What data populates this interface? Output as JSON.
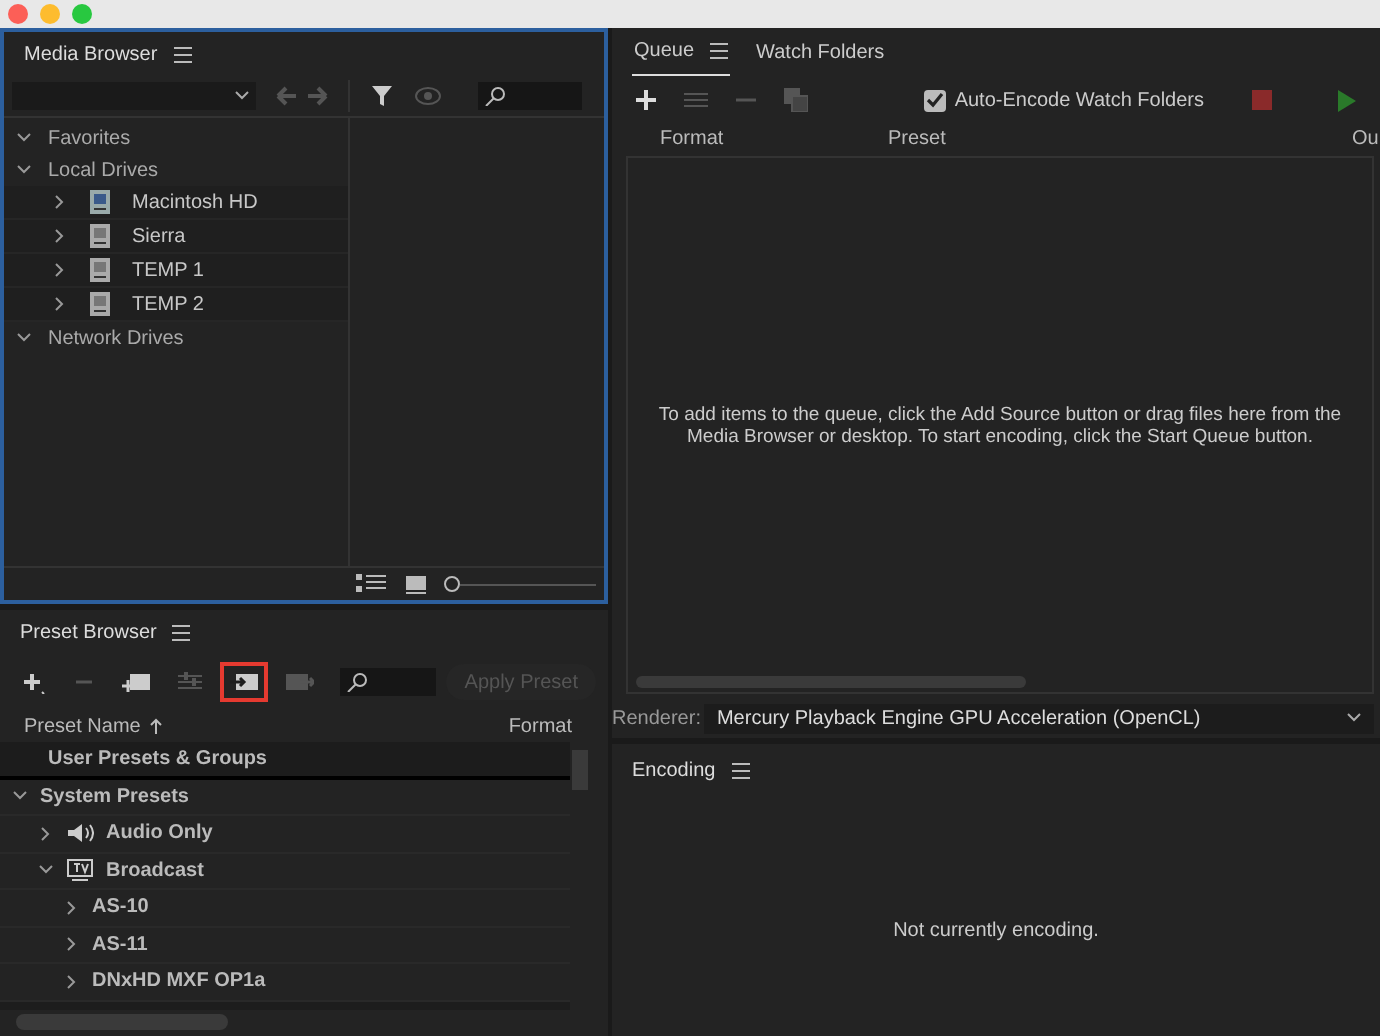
{
  "media_browser": {
    "title": "Media Browser",
    "tree": [
      {
        "label": "Favorites",
        "expanded": true
      },
      {
        "label": "Local Drives",
        "expanded": true,
        "children": [
          {
            "label": "Macintosh HD",
            "kind": "system-drive",
            "expanded": false
          },
          {
            "label": "Sierra",
            "kind": "drive",
            "expanded": false
          },
          {
            "label": "TEMP 1",
            "kind": "drive",
            "expanded": false
          },
          {
            "label": "TEMP 2",
            "kind": "drive",
            "expanded": false
          }
        ]
      },
      {
        "label": "Network Drives",
        "expanded": true
      }
    ],
    "zoom_slider": {
      "level": 0
    }
  },
  "preset_browser": {
    "title": "Preset Browser",
    "tools": [
      {
        "kind": "add",
        "disabled": false,
        "highlighted": false
      },
      {
        "kind": "remove",
        "disabled": true,
        "highlighted": false
      },
      {
        "kind": "new-group",
        "disabled": false,
        "highlighted": false
      },
      {
        "kind": "settings",
        "disabled": true,
        "highlighted": false
      },
      {
        "kind": "import",
        "disabled": false,
        "highlighted": true
      },
      {
        "kind": "export",
        "disabled": true,
        "highlighted": false
      }
    ],
    "apply_button": {
      "label": "Apply Preset",
      "disabled": true
    },
    "columns": [
      "Preset Name",
      "Format"
    ],
    "tree": [
      {
        "label": "User Presets & Groups",
        "kind": "group"
      },
      {
        "label": "System Presets",
        "expanded": true,
        "children": [
          {
            "label": "Audio Only",
            "kind": "audio",
            "expanded": false
          },
          {
            "label": "Broadcast",
            "kind": "tv",
            "expanded": true,
            "children": [
              {
                "label": "AS-10",
                "expanded": false
              },
              {
                "label": "AS-11",
                "expanded": false
              },
              {
                "label": "DNxHD MXF OP1a",
                "expanded": false
              }
            ]
          }
        ]
      }
    ]
  },
  "queue": {
    "tabs": [
      {
        "label": "Queue",
        "selected": true
      },
      {
        "label": "Watch Folders",
        "selected": false
      }
    ],
    "auto_encode": {
      "label": "Auto-Encode Watch Folders",
      "checked": true
    },
    "columns": [
      "Format",
      "Preset",
      "Ou"
    ],
    "empty_message": "To add items to the queue, click the Add Source button or drag files here from the Media Browser or desktop.  To start encoding, click the Start Queue button.",
    "renderer": {
      "label": "Renderer:",
      "value": "Mercury Playback Engine GPU Acceleration (OpenCL)"
    }
  },
  "encoding": {
    "title": "Encoding",
    "message": "Not currently encoding."
  }
}
